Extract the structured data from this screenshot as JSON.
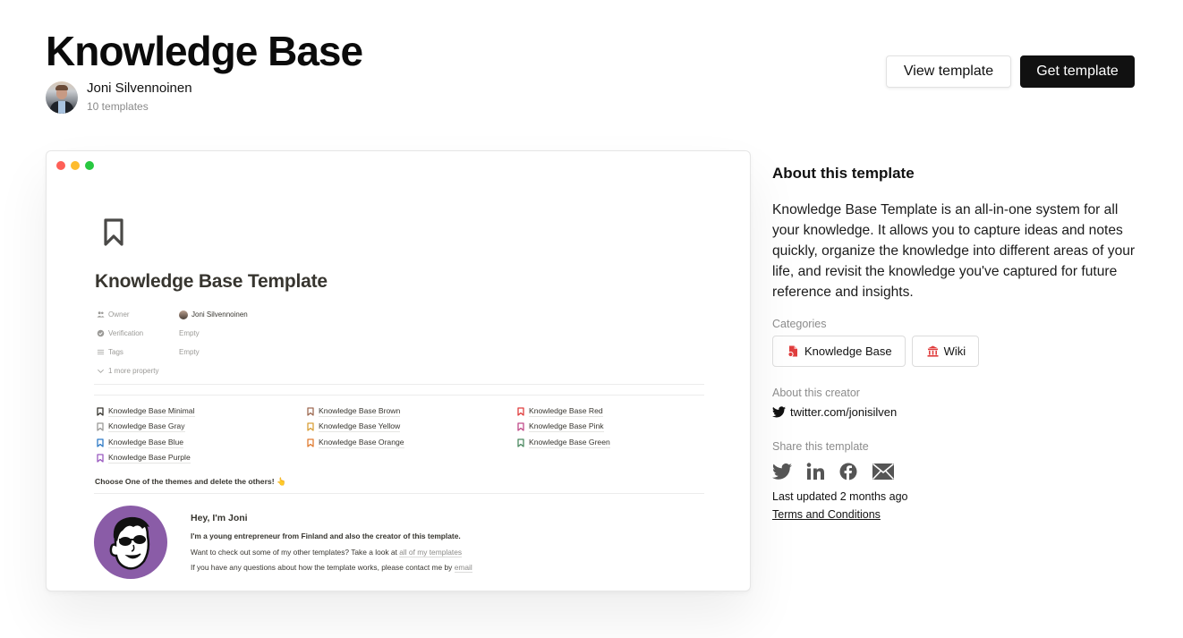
{
  "header": {
    "title": "Knowledge Base",
    "creator_name": "Joni Silvennoinen",
    "creator_templates": "10 templates",
    "view_button": "View template",
    "get_button": "Get template"
  },
  "preview": {
    "window_dots": [
      "close",
      "minimize",
      "maximize"
    ],
    "page_icon": "bookmark-icon",
    "page_title": "Knowledge Base Template",
    "properties": [
      {
        "key": "Owner",
        "icon": "people-icon",
        "value": "Joni Silvennoinen"
      },
      {
        "key": "Verification",
        "icon": "verified-icon",
        "value": "Empty"
      },
      {
        "key": "Tags",
        "icon": "list-icon",
        "value": "Empty"
      }
    ],
    "more_properties": "1 more property",
    "themes": [
      {
        "label": "Knowledge Base Minimal",
        "color": "#37352f"
      },
      {
        "label": "Knowledge Base Brown",
        "color": "#9f6b53"
      },
      {
        "label": "Knowledge Base Red",
        "color": "#e03e3e"
      },
      {
        "label": "Knowledge Base Gray",
        "color": "#9b9a97"
      },
      {
        "label": "Knowledge Base Yellow",
        "color": "#d9a03a"
      },
      {
        "label": "Knowledge Base Pink",
        "color": "#c14c8a"
      },
      {
        "label": "Knowledge Base Blue",
        "color": "#2f7bc6"
      },
      {
        "label": "Knowledge Base Orange",
        "color": "#e07d33"
      },
      {
        "label": "Knowledge Base Green",
        "color": "#4d8a62"
      },
      {
        "label": "Knowledge Base Purple",
        "color": "#9a5ac0"
      }
    ],
    "choose_text": "Choose One of the themes and delete the others! 👆",
    "bio": {
      "greeting": "Hey, I'm Joni",
      "line1": "I'm a young entrepreneur from Finland and also the creator of this template.",
      "line2_prefix": "Want to check out some of my other templates? Take a look at ",
      "line2_link": "all of my templates",
      "line3_prefix": "If you have any questions about how the template works, please contact me by ",
      "line3_link": "email"
    }
  },
  "sidebar": {
    "about_heading": "About this template",
    "about_text": "Knowledge Base Template is an all-in-one system for all your knowledge. It allows you to capture ideas and notes quickly, organize the knowledge into different areas of your life, and revisit the knowledge you've captured for future reference and insights.",
    "categories_label": "Categories",
    "categories": [
      {
        "label": "Knowledge Base",
        "icon": "document-icon",
        "color": "#e03e3e"
      },
      {
        "label": "Wiki",
        "icon": "bank-icon",
        "color": "#e03e3e"
      }
    ],
    "creator_label": "About this creator",
    "twitter_link": "twitter.com/jonisilven",
    "share_label": "Share this template",
    "share_icons": [
      "twitter-icon",
      "linkedin-icon",
      "facebook-icon",
      "mail-icon"
    ],
    "last_updated": "Last updated 2 months ago",
    "terms": "Terms and Conditions"
  }
}
